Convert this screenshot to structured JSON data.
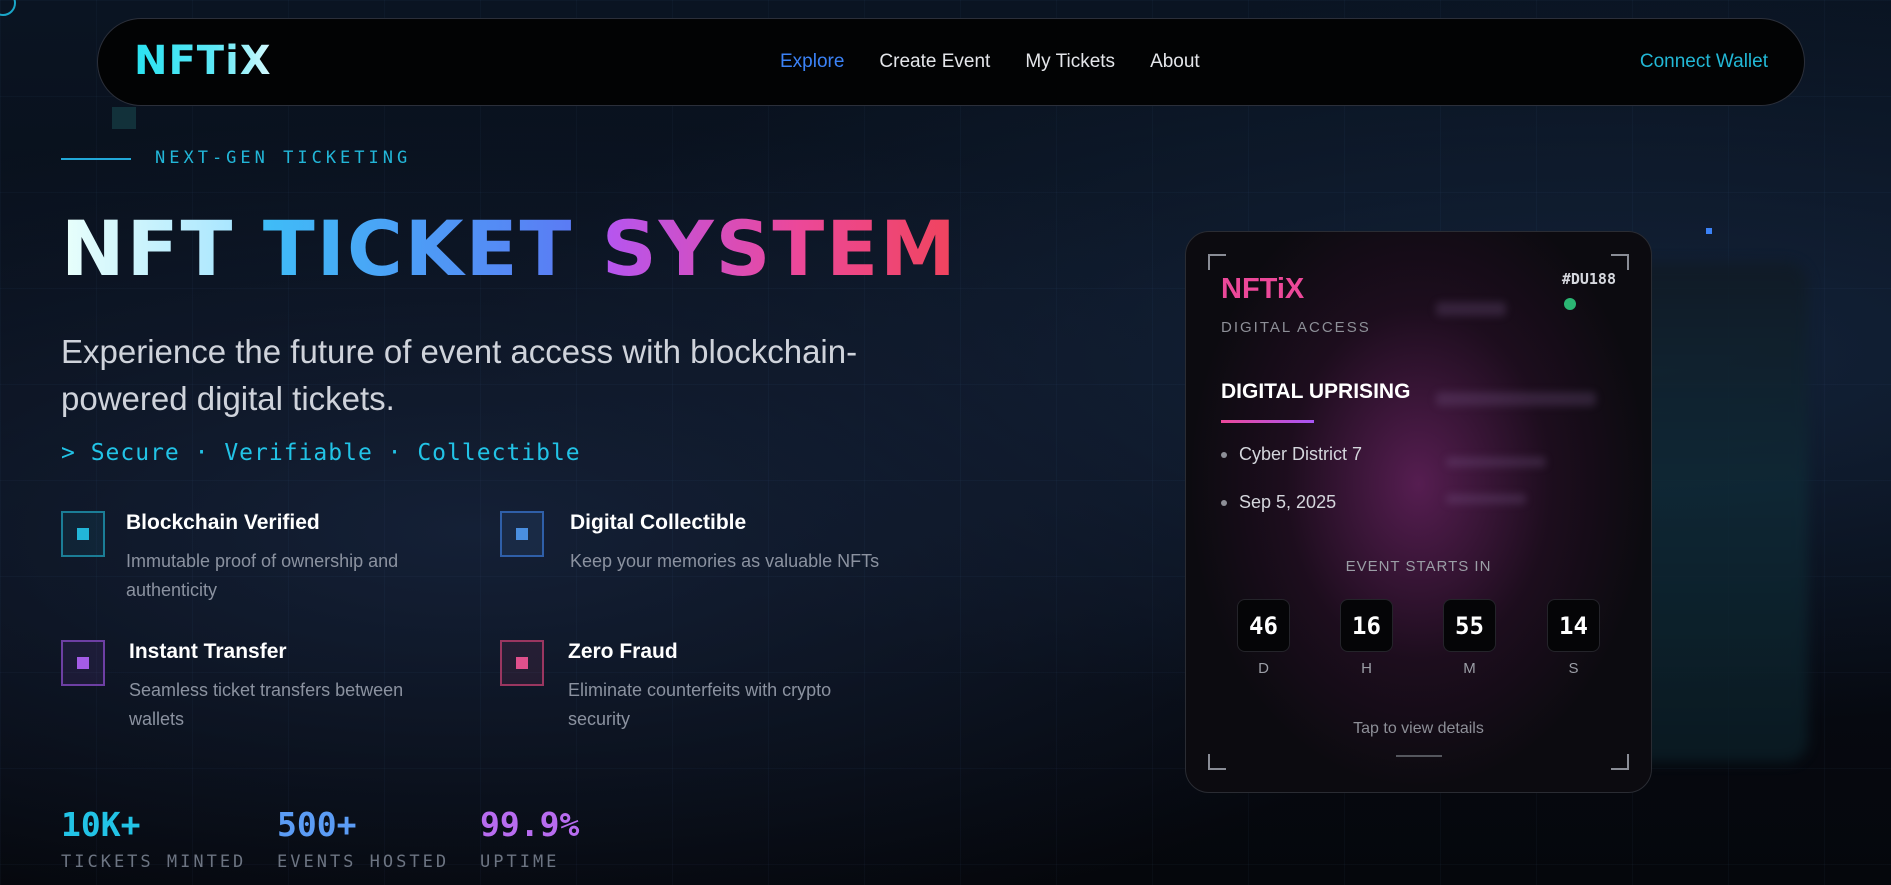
{
  "nav": {
    "logo": "NFTiX",
    "links": [
      "Explore",
      "Create Event",
      "My Tickets",
      "About"
    ],
    "active_link": "Explore",
    "connect": "Connect Wallet"
  },
  "hero": {
    "eyebrow": "NEXT-GEN TICKETING",
    "title": {
      "part1": "NFT",
      "part2": "TICKET",
      "part3": "SYSTEM"
    },
    "subtitle": "Experience the future of event access with blockchain-powered digital tickets.",
    "tagline": "> Secure · Verifiable · Collectible"
  },
  "features": [
    {
      "title": "Blockchain Verified",
      "desc": "Immutable proof of ownership and authenticity",
      "color": "#22b6d8"
    },
    {
      "title": "Digital Collectible",
      "desc": "Keep your memories as valuable NFTs",
      "color": "#4a8fe0"
    },
    {
      "title": "Instant Transfer",
      "desc": "Seamless ticket transfers between wallets",
      "color": "#a45ce6"
    },
    {
      "title": "Zero Fraud",
      "desc": "Eliminate counterfeits with crypto security",
      "color": "#e0508c"
    }
  ],
  "stats": [
    {
      "value": "10K+",
      "label": "TICKETS MINTED",
      "color": "#22c3e6"
    },
    {
      "value": "500+",
      "label": "EVENTS HOSTED",
      "color": "#5b9cf5"
    },
    {
      "value": "99.9%",
      "label": "UPTIME",
      "color": "#b86cf0"
    }
  ],
  "ticket": {
    "logo": "NFTiX",
    "sub": "DIGITAL ACCESS",
    "id": "#DU188",
    "event": "DIGITAL UPRISING",
    "location": "Cyber District 7",
    "date": "Sep 5, 2025",
    "starts_label": "EVENT STARTS IN",
    "countdown": [
      {
        "value": "46",
        "unit": "D"
      },
      {
        "value": "16",
        "unit": "H"
      },
      {
        "value": "55",
        "unit": "M"
      },
      {
        "value": "14",
        "unit": "S"
      }
    ],
    "tap": "Tap to view details"
  }
}
